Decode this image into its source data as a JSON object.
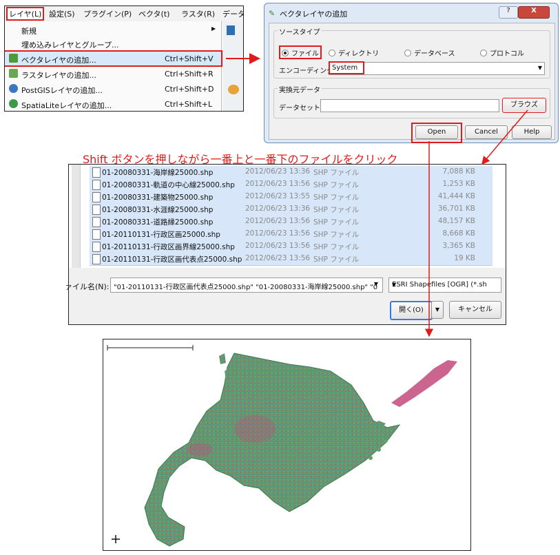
{
  "menu": {
    "top_items": [
      "レイヤ(L)",
      "設定(S)",
      "プラグイン(P)",
      "ベクタ(t)",
      "ラスタ(R)",
      "データ"
    ],
    "items": [
      {
        "label": "新規",
        "shortcut": "",
        "icon": "none",
        "submenu": true
      },
      {
        "label": "埋め込みレイヤとグループ...",
        "shortcut": "",
        "icon": "none",
        "submenu": false
      },
      {
        "label": "ベクタレイヤの追加...",
        "shortcut": "Ctrl+Shift+V",
        "icon": "vector-layer-icon",
        "submenu": false
      },
      {
        "label": "ラスタレイヤの追加...",
        "shortcut": "Ctrl+Shift+R",
        "icon": "raster-layer-icon",
        "submenu": false
      },
      {
        "label": "PostGISレイヤの追加...",
        "shortcut": "Ctrl+Shift+D",
        "icon": "postgis-layer-icon",
        "submenu": false
      },
      {
        "label": "SpatiaLiteレイヤの追加...",
        "shortcut": "Ctrl+Shift+L",
        "icon": "spatialite-layer-icon",
        "submenu": false
      }
    ]
  },
  "dialog": {
    "title": "ベクタレイヤの追加",
    "help_button": "?",
    "close_button": "X",
    "source_type": {
      "label": "ソースタイプ",
      "options": [
        "ファイル",
        "ディレクトリ",
        "データベース",
        "プロトコル"
      ],
      "selected": "ファイル"
    },
    "encoding": {
      "label": "エンコーディング",
      "value": "System"
    },
    "source_data": {
      "label": "実換元データ",
      "dataset_label": "データセット",
      "dataset_value": "",
      "browse_button": "ブラウズ"
    },
    "buttons": {
      "open": "Open",
      "cancel": "Cancel",
      "help": "Help"
    }
  },
  "instruction": "Shift ボタンを押しながら一番上と一番下のファイルをクリック",
  "file_dialog": {
    "files": [
      {
        "name": "01-20080331-海岸線25000.shp",
        "date": "2012/06/23 13:36",
        "type": "SHP ファイル",
        "size": "7,088 KB"
      },
      {
        "name": "01-20080331-軌道の中心線25000.shp",
        "date": "2012/06/23 13:56",
        "type": "SHP ファイル",
        "size": "1,253 KB"
      },
      {
        "name": "01-20080331-建築物25000.shp",
        "date": "2012/06/23 13:55",
        "type": "SHP ファイル",
        "size": "41,444 KB"
      },
      {
        "name": "01-20080331-水涯線25000.shp",
        "date": "2012/06/23 13:36",
        "type": "SHP ファイル",
        "size": "36,701 KB"
      },
      {
        "name": "01-20080331-道路縁25000.shp",
        "date": "2012/06/23 13:56",
        "type": "SHP ファイル",
        "size": "48,157 KB"
      },
      {
        "name": "01-20110131-行政区画25000.shp",
        "date": "2012/06/23 13:56",
        "type": "SHP ファイル",
        "size": "8,668 KB"
      },
      {
        "name": "01-20110131-行政区画界線25000.shp",
        "date": "2012/06/23 13:56",
        "type": "SHP ファイル",
        "size": "3,365 KB"
      },
      {
        "name": "01-20110131-行政区画代表点25000.shp",
        "date": "2012/06/23 13:56",
        "type": "SHP ファイル",
        "size": "19 KB"
      }
    ],
    "filename_label": "ァイル名(N):",
    "filename_value": "\"01-20110131-行政区画代表点25000.shp\" \"01-20080331-海岸線25000.shp\" \"0",
    "filetype_value": "ESRI Shapefiles [OGR] (*.sh",
    "open_button": "開く(O)",
    "cancel_button": "キャンセル"
  },
  "map": {
    "description_icon": "hokkaido-map-render",
    "colors": {
      "land_green": "#5ea36a",
      "urban_pink": "#c24a7c",
      "road_blue": "#4a6fb0"
    }
  },
  "colors": {
    "highlight_red": "#e01b1b",
    "selection_blue": "#d7e6f8"
  }
}
